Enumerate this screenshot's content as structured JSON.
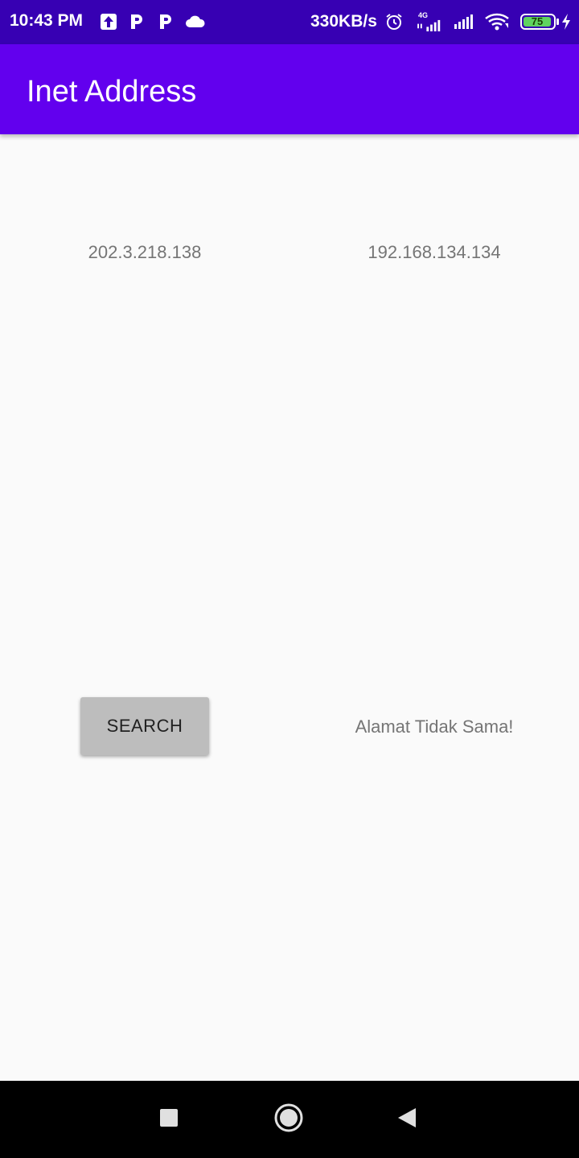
{
  "status_bar": {
    "time": "10:43 PM",
    "network_speed": "330KB/s",
    "network_type": "4G",
    "battery_level": "75",
    "icons": [
      "upload-icon",
      "p-icon",
      "p-icon",
      "cloud-icon",
      "alarm-icon",
      "signal-4g-icon",
      "signal-icon",
      "wifi-icon",
      "battery-icon",
      "charging-icon"
    ]
  },
  "app_bar": {
    "title": "Inet Address",
    "color": "#6200ee"
  },
  "main": {
    "address_1": "202.3.218.138",
    "address_2": "192.168.134.134",
    "search_button_label": "SEARCH",
    "result_text": "Alamat Tidak Sama!"
  },
  "nav_bar": {
    "icons": [
      "recents-icon",
      "home-icon",
      "back-icon"
    ]
  },
  "colors": {
    "status_bar": "#3700b3",
    "accent": "#6200ee",
    "background": "#fafafa",
    "button": "#bdbdbd"
  }
}
